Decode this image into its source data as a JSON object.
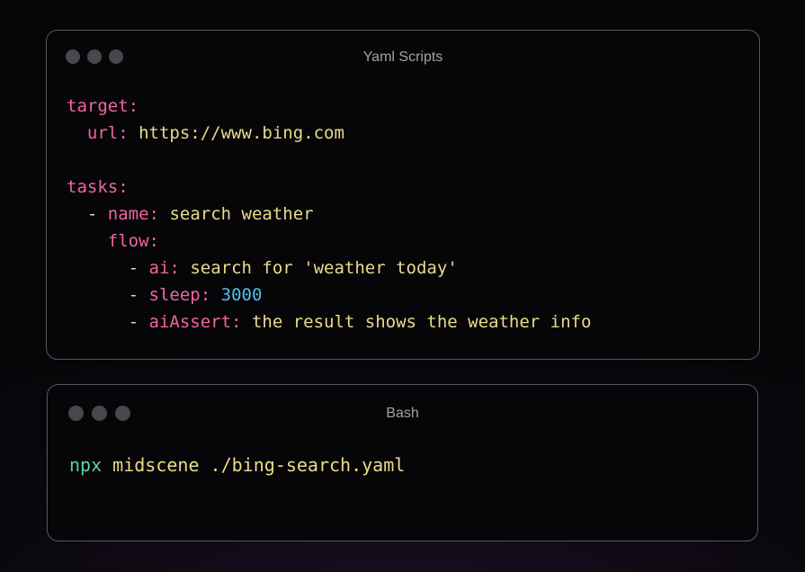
{
  "yaml_window": {
    "title": "Yaml Scripts",
    "lines": {
      "target_key": "target:",
      "url_key": "url:",
      "url_value": "https://www.bing.com",
      "tasks_key": "tasks:",
      "dash": "-",
      "name_key": "name:",
      "name_value": "search weather",
      "flow_key": "flow:",
      "ai_key": "ai:",
      "ai_value": "search for 'weather today'",
      "sleep_key": "sleep:",
      "sleep_value": "3000",
      "aiassert_key": "aiAssert:",
      "aiassert_value": "the result shows the weather info"
    }
  },
  "bash_window": {
    "title": "Bash",
    "command": "npx",
    "args": "midscene ./bing-search.yaml"
  },
  "colors": {
    "key": "#f0669d",
    "string": "#e8dc8c",
    "number": "#4fc1f0",
    "command": "#5dd3a9"
  }
}
